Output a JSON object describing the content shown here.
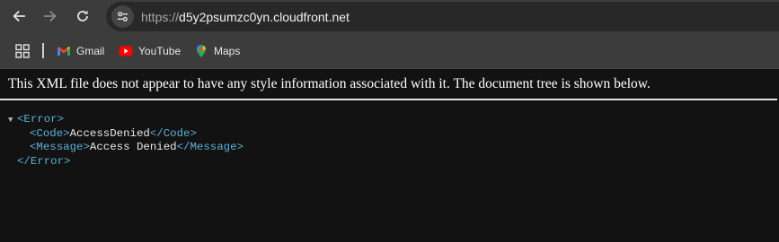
{
  "browser": {
    "url_scheme": "https://",
    "url_host": "d5y2psumzc0yn.cloudfront.net",
    "nav": {
      "back_icon": "arrow-left-icon",
      "forward_icon": "arrow-right-icon",
      "reload_icon": "reload-icon",
      "site_info_icon": "tune-icon"
    }
  },
  "bookmarks": {
    "apps_icon": "apps-grid-icon",
    "items": [
      {
        "label": "Gmail",
        "icon": "gmail-icon"
      },
      {
        "label": "YouTube",
        "icon": "youtube-icon"
      },
      {
        "label": "Maps",
        "icon": "maps-icon"
      }
    ]
  },
  "page": {
    "notice": "This XML file does not appear to have any style information associated with it. The document tree is shown below.",
    "xml": {
      "root_open": "<Error>",
      "root_close": "</Error>",
      "code_open": "<Code>",
      "code_value": "AccessDenied",
      "code_close": "</Code>",
      "message_open": "<Message>",
      "message_value": "Access Denied",
      "message_close": "</Message>",
      "toggle_glyph": "▼"
    }
  },
  "colors": {
    "xml_tag": "#5db0d7",
    "toolbar_bg": "#3c3c3c",
    "page_bg": "#121212"
  }
}
